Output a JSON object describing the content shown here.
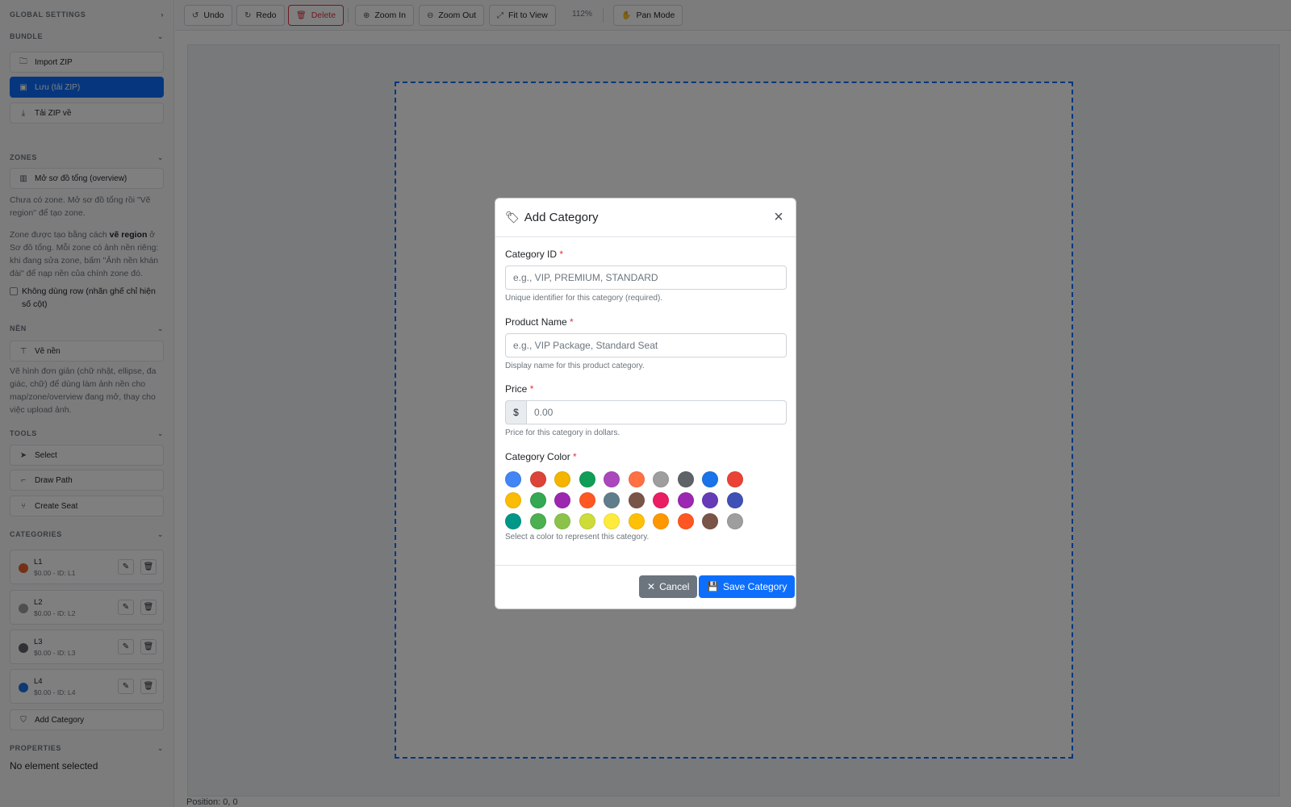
{
  "sidebar": {
    "global_settings": "GLOBAL SETTINGS",
    "bundle": {
      "title": "BUNDLE",
      "import_zip": "Import ZIP",
      "save_zip": "Lưu (tải ZIP)",
      "download_zip": "Tải ZIP về"
    },
    "zones": {
      "title": "ZONES",
      "open_overview": "Mở sơ đồ tổng (overview)",
      "help1": "Chưa có zone. Mở sơ đồ tổng rồi \"Vẽ region\" để tạo zone.",
      "help2_a": "Zone được tạo bằng cách ",
      "help2_b": "vẽ region",
      "help2_c": " ở Sơ đồ tổng. Mỗi zone có ảnh nền riêng: khi đang sửa zone, bấm \"Ảnh nền khán đài\" để nạp nền của chính zone đó.",
      "no_row_label": "Không dùng row (nhãn ghế chỉ hiện số cột)"
    },
    "background": {
      "title": "NỀN",
      "draw_bg": "Vẽ nền",
      "help": "Vẽ hình đơn giản (chữ nhật, ellipse, đa giác, chữ) để dùng làm ảnh nền cho map/zone/overview đang mở, thay cho việc upload ảnh."
    },
    "tools": {
      "title": "TOOLS",
      "select": "Select",
      "draw_path": "Draw Path",
      "create_seat": "Create Seat"
    },
    "categories": {
      "title": "CATEGORIES",
      "items": [
        {
          "name": "L1",
          "meta": "$0.00 - ID: L1",
          "color": "#e8622d"
        },
        {
          "name": "L2",
          "meta": "$0.00 - ID: L2",
          "color": "#9e9e9e"
        },
        {
          "name": "L3",
          "meta": "$0.00 - ID: L3",
          "color": "#5f6368"
        },
        {
          "name": "L4",
          "meta": "$0.00 - ID: L4",
          "color": "#1a73e8"
        }
      ],
      "add": "Add Category"
    },
    "properties": {
      "title": "PROPERTIES",
      "empty": "No element selected"
    }
  },
  "toolbar": {
    "undo": "Undo",
    "redo": "Redo",
    "delete": "Delete",
    "zoom_in": "Zoom In",
    "zoom_out": "Zoom Out",
    "fit": "Fit to View",
    "zoom_level": "112%",
    "pan": "Pan Mode"
  },
  "status": {
    "position": "Position: 0, 0"
  },
  "modal": {
    "title": "Add Category",
    "category_id": {
      "label": "Category ID",
      "placeholder": "e.g., VIP, PREMIUM, STANDARD",
      "hint": "Unique identifier for this category (required)."
    },
    "product_name": {
      "label": "Product Name",
      "placeholder": "e.g., VIP Package, Standard Seat",
      "hint": "Display name for this product category."
    },
    "price": {
      "label": "Price",
      "addon": "$",
      "placeholder": "0.00",
      "hint": "Price for this category in dollars."
    },
    "color": {
      "label": "Category Color",
      "hint": "Select a color to represent this category.",
      "swatches": [
        [
          "#4285f4",
          "#db4437",
          "#f4b400",
          "#0f9d58",
          "#ab47bc",
          "#ff7043",
          "#9e9e9e",
          "#5f6368",
          "#1a73e8",
          "#ea4335"
        ],
        [
          "#fbbc05",
          "#34a853",
          "#9c27b0",
          "#ff5722",
          "#607d8b",
          "#795548",
          "#e91e63",
          "#9c27b0",
          "#673ab7",
          "#3f51b5"
        ],
        [
          "#009688",
          "#4caf50",
          "#8bc34a",
          "#cddc39",
          "#ffeb3b",
          "#ffc107",
          "#ff9800",
          "#ff5722",
          "#795548",
          "#9e9e9e"
        ]
      ]
    },
    "cancel": "Cancel",
    "save": "Save Category"
  }
}
